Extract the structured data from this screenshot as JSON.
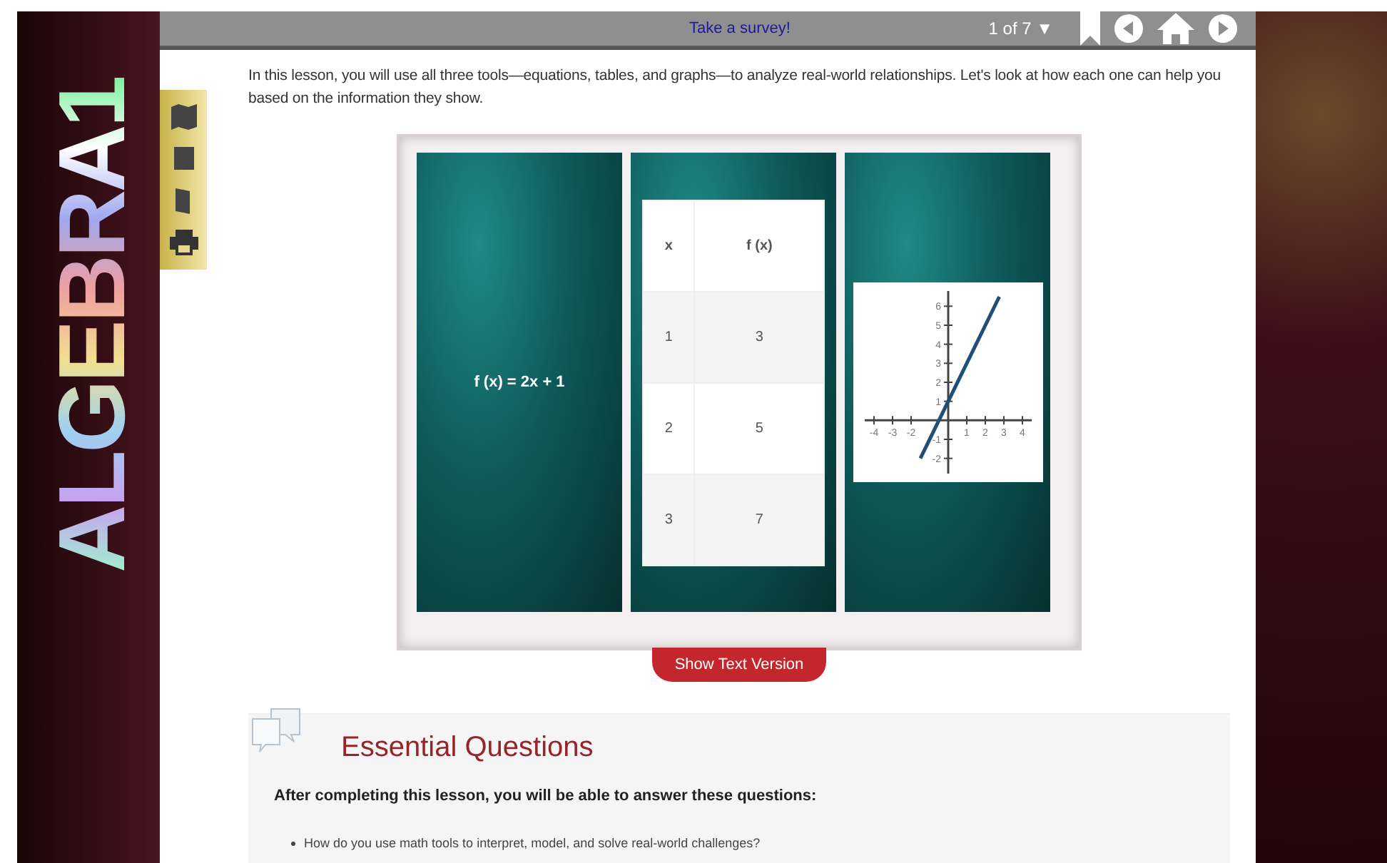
{
  "logo": {
    "text": "ALGEBRA1"
  },
  "top_bar": {
    "survey_link": "Take a survey!",
    "page_indicator": "1 of 7 ▼"
  },
  "tools": [
    {
      "kind": "map"
    },
    {
      "kind": "notebook"
    },
    {
      "kind": "book"
    },
    {
      "kind": "print"
    }
  ],
  "intro": "In this lesson, you will use all three tools—equations, tables, and graphs—to analyze real-world relationships. Let's look at how each one can help you based on the information they show.",
  "panels": [
    {
      "kind": "equation",
      "text": "f (x) = 2x + 1"
    },
    {
      "kind": "table",
      "columns": [
        "x",
        "f (x)"
      ],
      "rows": [
        [
          "1",
          "3"
        ],
        [
          "2",
          "5"
        ],
        [
          "3",
          "7"
        ]
      ]
    },
    {
      "kind": "graph",
      "chart_data": {
        "type": "line",
        "x": [
          -1.5,
          2.75
        ],
        "series": [
          {
            "color": "#1f4e79",
            "values": [
              -2,
              6.5
            ]
          }
        ],
        "xlim": [
          -4.5,
          4.5
        ],
        "ylim": [
          -2.8,
          6.8
        ],
        "xticks": [
          -4,
          -3,
          -2,
          1,
          2,
          3,
          4
        ],
        "yticks": [
          -2,
          -1,
          1,
          2,
          3,
          4,
          5,
          6
        ]
      }
    }
  ],
  "show_text_button": "Show Text Version",
  "essential": {
    "title": "Essential Questions",
    "subtitle": "After completing this lesson, you will be able to answer these questions:",
    "questions": [
      "How do you use math tools to interpret, model, and solve real-world challenges?"
    ]
  }
}
